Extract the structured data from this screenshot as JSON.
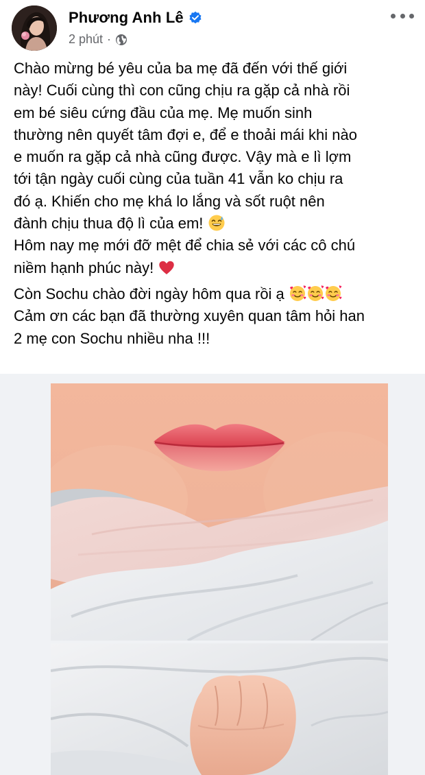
{
  "post": {
    "author": "Phương Anh Lê",
    "verified": true,
    "time": "2 phút",
    "separator": "·",
    "audience_icon": "globe-icon",
    "more_icon": "more-options-icon",
    "lines": [
      "Chào mừng bé yêu của ba mẹ đã đến với thế giới",
      "này! Cuối cùng thì con cũng chịu ra gặp cả nhà rồi",
      "em bé siêu cứng đầu của mẹ. Mẹ muốn sinh",
      "thường nên quyết tâm đợi e, để e thoải mái khi nào",
      "e muốn ra gặp cả nhà cũng được. Vậy mà e lì lợm",
      "tới tận ngày cuối cùng của tuần 41 vẫn ko chịu ra",
      "đó ạ. Khiến cho mẹ khá lo lắng và sốt ruột nên",
      "đành chịu thua độ lì của em! ",
      "Hôm nay mẹ mới đỡ mệt để chia sẻ với các cô chú",
      "niềm hạnh phúc này! ",
      "Còn Sochu chào đời ngày hôm qua rồi ạ ",
      "Cảm ơn các bạn đã thường xuyên quan tâm hỏi han",
      "2 mẹ con Sochu nhiều nha !!!"
    ],
    "emoji_names": {
      "sweat_smile": "sweat-smile-emoji",
      "heart": "red-heart-emoji",
      "smiling_hearts": "smiling-face-with-hearts-emoji"
    }
  },
  "colors": {
    "text": "#050505",
    "secondary": "#65676b",
    "verified_blue": "#1877f2",
    "media_bg": "#f0f2f5"
  }
}
